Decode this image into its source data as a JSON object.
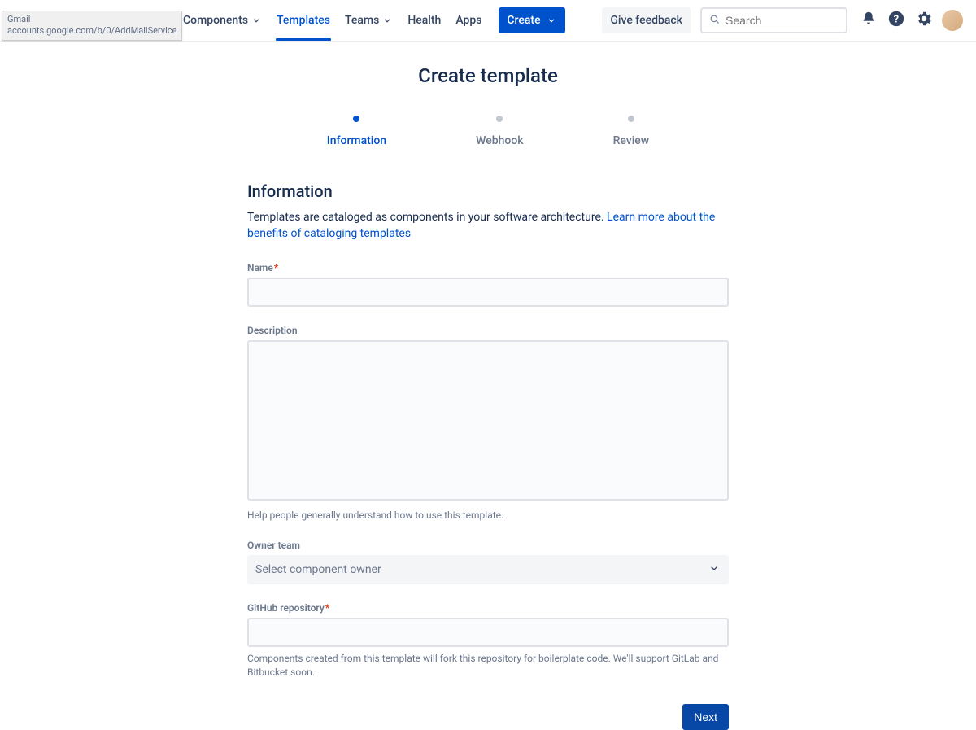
{
  "tooltip": {
    "title": "Gmail",
    "url": "accounts.google.com/b/0/AddMailService"
  },
  "nav": {
    "components": "Components",
    "templates": "Templates",
    "teams": "Teams",
    "health": "Health",
    "apps": "Apps",
    "create": "Create",
    "feedback": "Give feedback",
    "search_placeholder": "Search"
  },
  "page": {
    "title": "Create template"
  },
  "stepper": {
    "information": "Information",
    "webhook": "Webhook",
    "review": "Review"
  },
  "form": {
    "section_title": "Information",
    "section_desc_text": "Templates are cataloged as components in your software architecture. ",
    "section_desc_link": "Learn more about the benefits of cataloging templates",
    "name_label": "Name",
    "description_label": "Description",
    "description_help": "Help people generally understand how to use this template.",
    "owner_label": "Owner team",
    "owner_placeholder": "Select component owner",
    "repo_label": "GitHub repository",
    "repo_help": "Components created from this template will fork this repository for boilerplate code. We'll support GitLab and Bitbucket soon.",
    "next": "Next"
  }
}
